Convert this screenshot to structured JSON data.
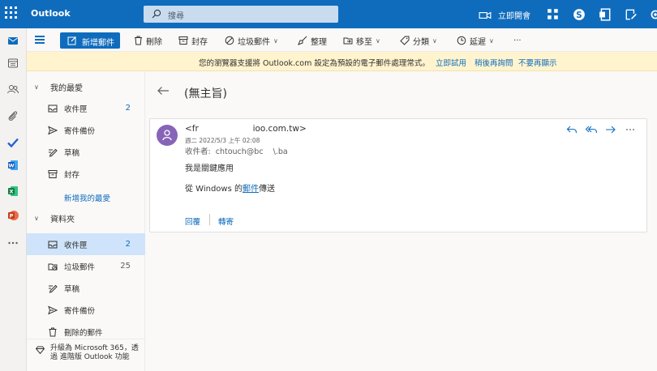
{
  "header": {
    "app_name": "Outlook",
    "search_placeholder": "搜尋",
    "meet_now": "立即開會",
    "accent": "#0f6cbd"
  },
  "toolbar": {
    "new_mail": "新增郵件",
    "delete": "刪除",
    "archive": "封存",
    "junk": "垃圾郵件",
    "sweep": "整理",
    "move_to": "移至",
    "categorize": "分類",
    "snooze": "延遲",
    "more": "···"
  },
  "banner": {
    "text": "您的瀏覽器支援將 Outlook.com 設定為預設的電子郵件處理常式。",
    "try_now": "立即試用",
    "ask_later": "稍後再詢問",
    "dont_show": "不要再顯示"
  },
  "folders": {
    "favorites_title": "我的最愛",
    "favorites": [
      {
        "label": "收件匣",
        "count": "2"
      },
      {
        "label": "寄件備份",
        "count": ""
      },
      {
        "label": "草稿",
        "count": ""
      },
      {
        "label": "封存",
        "count": ""
      }
    ],
    "add_favorite": "新增我的最愛",
    "folders_title": "資料夾",
    "items": [
      {
        "label": "收件匣",
        "count": "2"
      },
      {
        "label": "垃圾郵件",
        "count": "25"
      },
      {
        "label": "草稿",
        "count": ""
      },
      {
        "label": "寄件備份",
        "count": ""
      },
      {
        "label": "刪除的郵件",
        "count": ""
      }
    ],
    "upgrade": "升級為 Microsoft 365，透過 進階版 Outlook 功能"
  },
  "message": {
    "subject": "(無主旨)",
    "sender": "<fr                    ioo.com.tw>",
    "date": "週二 2022/5/3 上午 02:08",
    "to": "收件者:  chtouch@bc    \\.ba",
    "body_line1": "我是關鍵應用",
    "body_prefix": "從 Windows 的",
    "body_link": "郵件",
    "body_suffix": "傳送",
    "reply": "回覆",
    "forward": "轉寄"
  }
}
